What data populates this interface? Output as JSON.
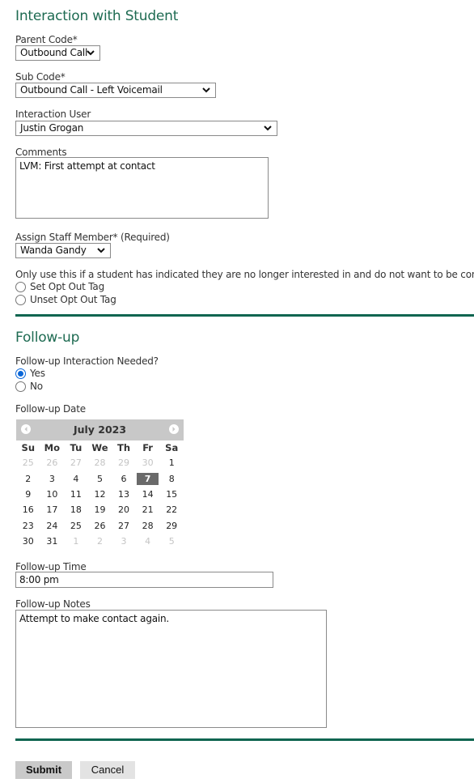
{
  "interaction": {
    "title": "Interaction with Student",
    "parent_code": {
      "label": "Parent Code*",
      "value": "Outbound Call"
    },
    "sub_code": {
      "label": "Sub Code*",
      "value": "Outbound Call - Left Voicemail"
    },
    "interaction_user": {
      "label": "Interaction User",
      "value": "Justin Grogan"
    },
    "comments": {
      "label": "Comments",
      "value": "LVM: First attempt at contact"
    },
    "assign_staff": {
      "label": "Assign Staff Member* (Required)",
      "value": "Wanda Gandy"
    },
    "opt_out": {
      "note": "Only use this if a student has indicated they are no longer interested in and do not want to be contacted. C",
      "options": [
        {
          "label": "Set Opt Out Tag",
          "checked": false
        },
        {
          "label": "Unset Opt Out Tag",
          "checked": false
        }
      ]
    }
  },
  "followup": {
    "title": "Follow-up",
    "needed": {
      "label": "Follow-up Interaction Needed?",
      "options": [
        {
          "label": "Yes",
          "checked": true
        },
        {
          "label": "No",
          "checked": false
        }
      ]
    },
    "date": {
      "label": "Follow-up Date",
      "calendar": {
        "month_title": "July 2023",
        "prev_icon": "chevron-left-circle",
        "next_icon": "chevron-right-circle",
        "weekdays": [
          "Su",
          "Mo",
          "Tu",
          "We",
          "Th",
          "Fr",
          "Sa"
        ],
        "weeks": [
          [
            {
              "d": "25",
              "o": true
            },
            {
              "d": "26",
              "o": true
            },
            {
              "d": "27",
              "o": true
            },
            {
              "d": "28",
              "o": true
            },
            {
              "d": "29",
              "o": true
            },
            {
              "d": "30",
              "o": true
            },
            {
              "d": "1"
            }
          ],
          [
            {
              "d": "2"
            },
            {
              "d": "3"
            },
            {
              "d": "4"
            },
            {
              "d": "5"
            },
            {
              "d": "6"
            },
            {
              "d": "7",
              "s": true
            },
            {
              "d": "8"
            }
          ],
          [
            {
              "d": "9"
            },
            {
              "d": "10"
            },
            {
              "d": "11"
            },
            {
              "d": "12"
            },
            {
              "d": "13"
            },
            {
              "d": "14"
            },
            {
              "d": "15"
            }
          ],
          [
            {
              "d": "16"
            },
            {
              "d": "17"
            },
            {
              "d": "18"
            },
            {
              "d": "19"
            },
            {
              "d": "20"
            },
            {
              "d": "21"
            },
            {
              "d": "22"
            }
          ],
          [
            {
              "d": "23"
            },
            {
              "d": "24"
            },
            {
              "d": "25"
            },
            {
              "d": "26"
            },
            {
              "d": "27"
            },
            {
              "d": "28"
            },
            {
              "d": "29"
            }
          ],
          [
            {
              "d": "30"
            },
            {
              "d": "31"
            },
            {
              "d": "1",
              "o": true
            },
            {
              "d": "2",
              "o": true
            },
            {
              "d": "3",
              "o": true
            },
            {
              "d": "4",
              "o": true
            },
            {
              "d": "5",
              "o": true
            }
          ]
        ],
        "selected_day": "7"
      }
    },
    "time": {
      "label": "Follow-up Time",
      "value": "8:00 pm"
    },
    "notes": {
      "label": "Follow-up Notes",
      "value": "Attempt to make contact again."
    }
  },
  "actions": {
    "submit_label": "Submit",
    "cancel_label": "Cancel"
  },
  "colors": {
    "accent": "#1e6b52",
    "rule": "#0e6550",
    "radio_checked": "#0b67d8",
    "calendar_header": "#c8c8c8",
    "selected_day": "#6a6a6a"
  }
}
